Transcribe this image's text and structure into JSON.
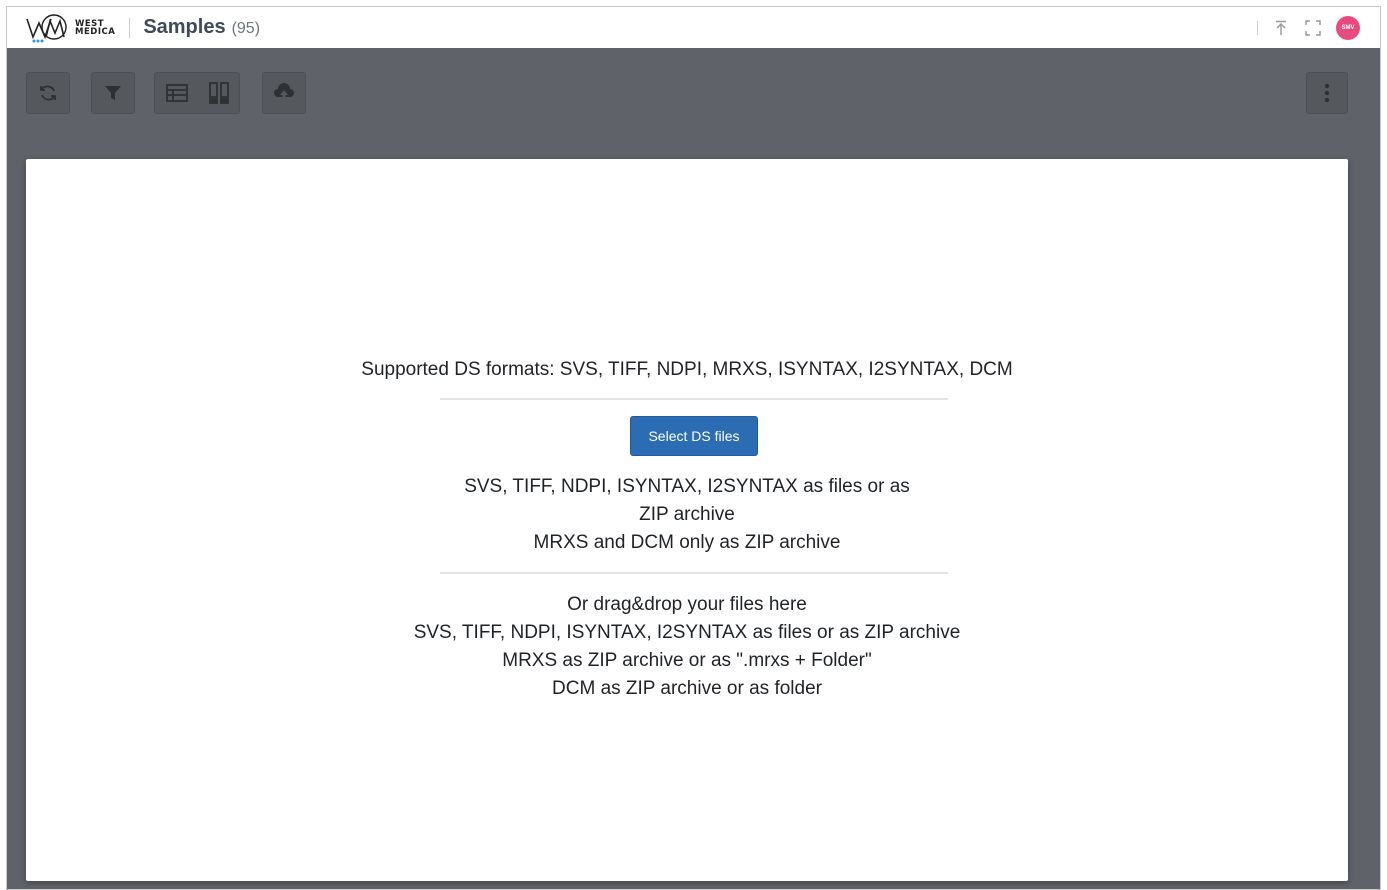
{
  "header": {
    "logo_line1": "WEST",
    "logo_line2": "MEDICA",
    "title": "Samples",
    "count": "(95)",
    "avatar_initials": "SMV",
    "avatar_color": "#e84a7f"
  },
  "toolbar": {
    "buttons": [
      "refresh-icon",
      "filter-icon",
      "table-view-icon",
      "card-view-icon",
      "upload-cloud-icon",
      "more-vertical-icon"
    ]
  },
  "modal": {
    "formats_heading": "Supported DS formats: SVS, TIFF, NDPI, MRXS, ISYNTAX, I2SYNTAX, DCM",
    "select_button": "Select DS files",
    "select_info_line1": "SVS, TIFF, NDPI, ISYNTAX, I2SYNTAX as files or as",
    "select_info_line2": "ZIP archive",
    "select_info_line3": "MRXS and DCM only as ZIP archive",
    "drop_line1": "Or drag&drop your files here",
    "drop_line2": "SVS, TIFF, NDPI, ISYNTAX, I2SYNTAX as files or as ZIP archive",
    "drop_line3": "MRXS as ZIP archive or as \".mrxs + Folder\"",
    "drop_line4": "DCM as ZIP archive or as folder"
  },
  "colors": {
    "accent": "#2b6cb3",
    "overlay": "#5f6268"
  }
}
